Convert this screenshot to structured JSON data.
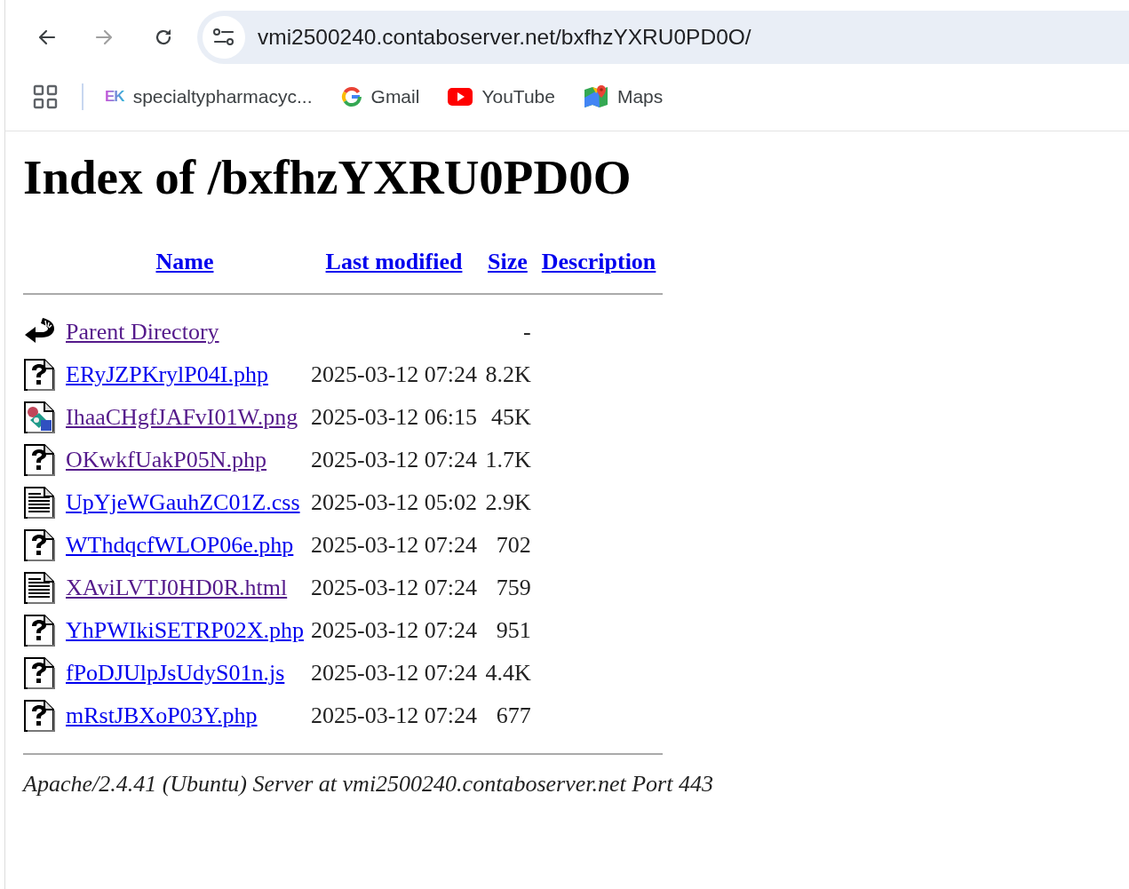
{
  "browser": {
    "buttons": [
      {
        "kind": "back",
        "disabled": false
      },
      {
        "kind": "forward",
        "disabled": true
      },
      {
        "kind": "reload",
        "disabled": false
      }
    ],
    "url": "vmi2500240.contaboserver.net/bxfhzYXRU0PD0O/",
    "bookmarks": [
      {
        "kind": "ek",
        "icon_text": "EK",
        "label": "specialtypharmacyc..."
      },
      {
        "kind": "google",
        "label": "Gmail"
      },
      {
        "kind": "youtube",
        "label": "YouTube"
      },
      {
        "kind": "maps",
        "label": "Maps"
      }
    ]
  },
  "page": {
    "title": "Index of /bxfhzYXRU0PD0O",
    "columns": [
      "Name",
      "Last modified",
      "Size",
      "Description"
    ],
    "rows": [
      {
        "kind": "back",
        "name": "Parent Directory",
        "visited": true,
        "size": "-"
      },
      {
        "kind": "unknown",
        "name": "ERyJZPKrylP04I.php",
        "visited": false,
        "modified": "2025-03-12 07:24",
        "size": "8.2K"
      },
      {
        "kind": "image",
        "name": "IhaaCHgfJAFvI01W.png",
        "visited": true,
        "modified": "2025-03-12 06:15",
        "size": "45K"
      },
      {
        "kind": "unknown",
        "name": "OKwkfUakP05N.php",
        "visited": true,
        "modified": "2025-03-12 07:24",
        "size": "1.7K"
      },
      {
        "kind": "text",
        "name": "UpYjeWGauhZC01Z.css",
        "visited": false,
        "modified": "2025-03-12 05:02",
        "size": "2.9K"
      },
      {
        "kind": "unknown",
        "name": "WThdqcfWLOP06e.php",
        "visited": false,
        "modified": "2025-03-12 07:24",
        "size": "702"
      },
      {
        "kind": "text",
        "name": "XAviLVTJ0HD0R.html",
        "visited": true,
        "modified": "2025-03-12 07:24",
        "size": "759"
      },
      {
        "kind": "unknown",
        "name": "YhPWIkiSETRP02X.php",
        "visited": false,
        "modified": "2025-03-12 07:24",
        "size": "951"
      },
      {
        "kind": "unknown",
        "name": "fPoDJUlpJsUdyS01n.js",
        "visited": false,
        "modified": "2025-03-12 07:24",
        "size": "4.4K"
      },
      {
        "kind": "unknown",
        "name": "mRstJBXoP03Y.php",
        "visited": false,
        "modified": "2025-03-12 07:24",
        "size": "677"
      }
    ],
    "footer": "Apache/2.4.41 (Ubuntu) Server at vmi2500240.contaboserver.net Port 443"
  }
}
